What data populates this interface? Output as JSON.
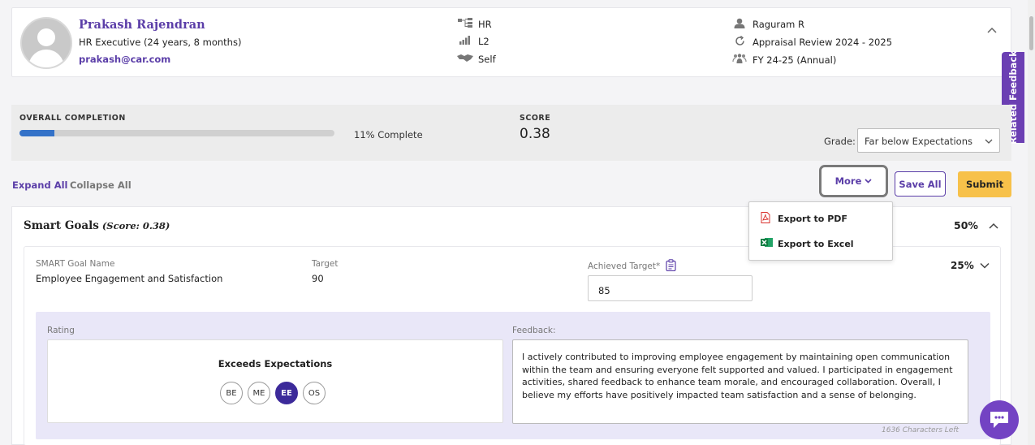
{
  "profile": {
    "name": "Prakash Rajendran",
    "title": "HR Executive (24 years, 8 months)",
    "email": "prakash@car.com"
  },
  "meta_middle": {
    "department": "HR",
    "level": "L2",
    "review_type": "Self"
  },
  "meta_right": {
    "reviewer": "Raguram R",
    "cycle": "Appraisal Review 2024 - 2025",
    "period": "FY 24-25 (Annual)"
  },
  "related_feedback_label": "Related Feedback",
  "completion": {
    "label": "OVERALL COMPLETION",
    "percent": 11,
    "text": "11% Complete",
    "score_label": "SCORE",
    "score_value": "0.38",
    "grade_label": "Grade:",
    "grade_value": "Far below Expectations"
  },
  "actions": {
    "expand_all": "Expand All",
    "collapse_all": "Collapse All",
    "more": "More",
    "save_all": "Save All",
    "submit": "Submit"
  },
  "more_menu": {
    "export_pdf": "Export to PDF",
    "export_excel": "Export to Excel"
  },
  "smart_goals": {
    "title": "Smart Goals",
    "score": "(Score: 0.38)",
    "weight": "50%",
    "goal": {
      "name_label": "SMART Goal Name",
      "name": "Employee Engagement and Satisfaction",
      "target_label": "Target",
      "target": "90",
      "achieved_label": "Achieved Target*",
      "achieved": "85",
      "weight": "25%",
      "rating_label": "Rating",
      "rating_text": "Exceeds Expectations",
      "rating_options": [
        "BE",
        "ME",
        "EE",
        "OS"
      ],
      "rating_selected": "EE",
      "feedback_label": "Feedback:",
      "feedback": "I actively contributed to improving employee engagement by maintaining open communication within the team and ensuring everyone felt supported and valued. I participated in engagement activities, shared feedback to enhance team morale, and encouraged collaboration. Overall, I believe my efforts have positively impacted team satisfaction and a sense of belonging.",
      "chars_left": "1636 Characters Left"
    }
  },
  "colors": {
    "brand": "#5b3ea8",
    "submit": "#f7c14a",
    "progress": "#3472c8",
    "rating_active": "#3c2a9a"
  }
}
